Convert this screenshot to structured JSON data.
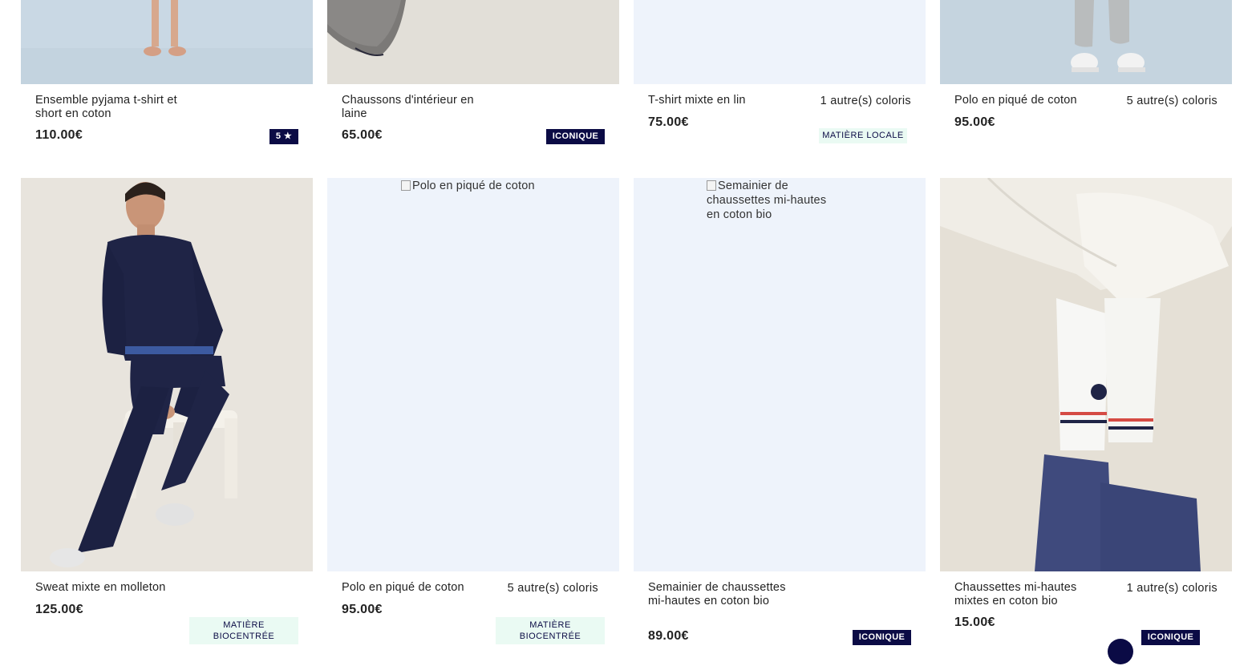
{
  "colors": {
    "navy": "#0b0b45",
    "placeholder_bg": "#eef3fb",
    "eco_badge_bg": "#eafaf3"
  },
  "row1": [
    {
      "name": "Ensemble pyjama t-shirt et short en coton",
      "price": "110.00€",
      "badge": "5 ★"
    },
    {
      "name": "Chaussons d'intérieur en laine",
      "price": "65.00€",
      "badge": "ICONIQUE"
    },
    {
      "name": "T-shirt mixte en lin",
      "price": "75.00€",
      "colors": "1 autre(s) coloris",
      "badge": "MATIÈRE LOCALE"
    },
    {
      "name": "Polo en piqué de coton",
      "price": "95.00€",
      "colors": "5 autre(s) coloris"
    }
  ],
  "row2": [
    {
      "name": "Sweat mixte en molleton",
      "price": "125.00€",
      "badge_l1": "MATIÈRE",
      "badge_l2": "BIOCENTRÉE"
    },
    {
      "name": "Polo en piqué de coton",
      "price": "95.00€",
      "colors": "5 autre(s) coloris",
      "badge_l1": "MATIÈRE",
      "badge_l2": "BIOCENTRÉE",
      "alt": "Polo en piqué de coton"
    },
    {
      "name": "Semainier de chaussettes mi-hautes en coton bio",
      "price": "89.00€",
      "badge": "ICONIQUE",
      "alt": "Semainier de chaussettes mi-hautes en coton bio"
    },
    {
      "name": "Chaussettes mi-hautes mixtes en coton bio",
      "price": "15.00€",
      "colors": "1 autre(s) coloris",
      "badge": "ICONIQUE"
    }
  ]
}
